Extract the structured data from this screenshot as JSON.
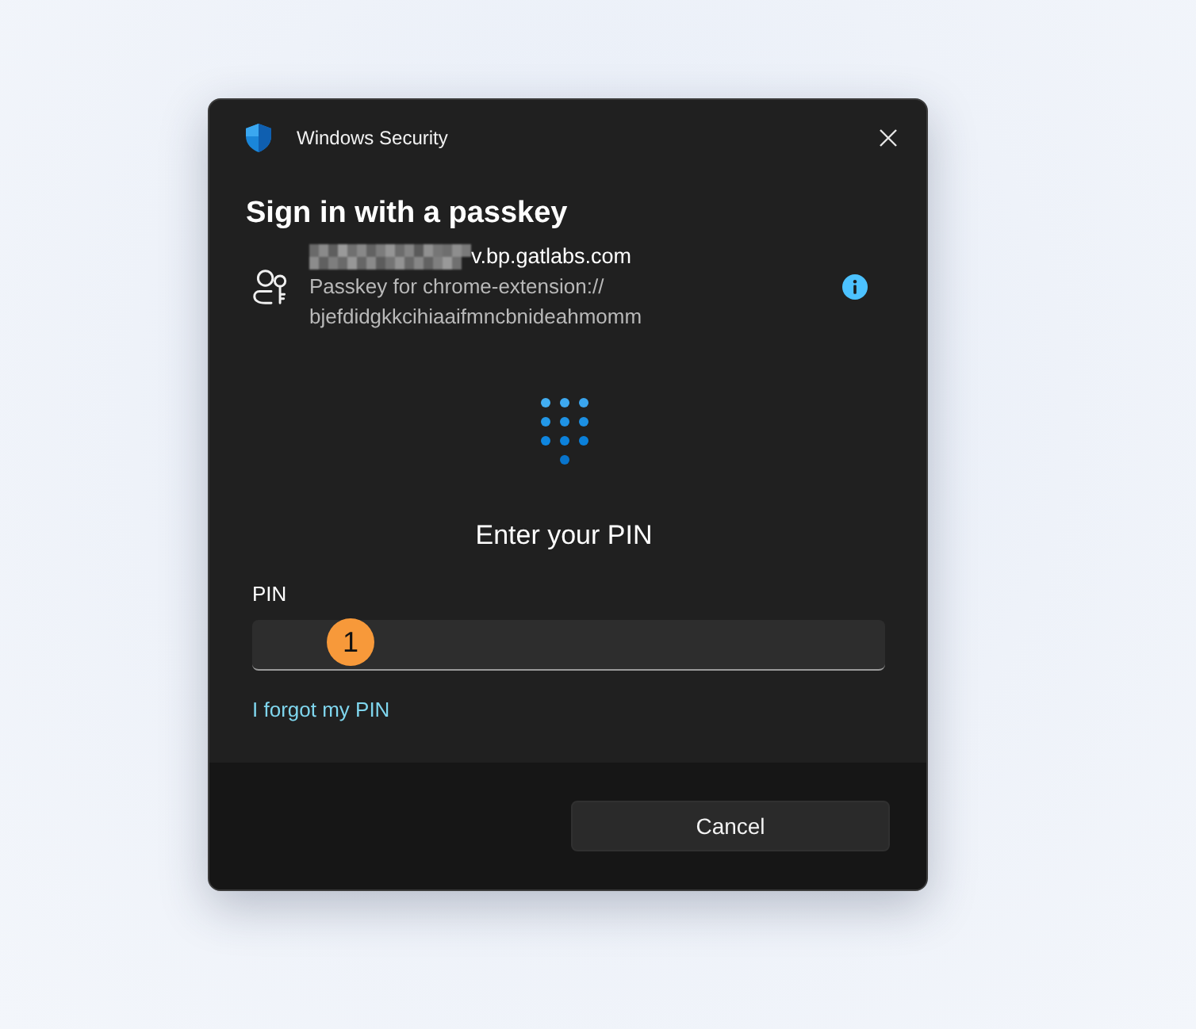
{
  "window": {
    "title": "Windows Security"
  },
  "dialog": {
    "heading": "Sign in with a passkey",
    "account": {
      "name_visible_part": "v.bp.gatlabs.com",
      "description": "Passkey for chrome-extension:// bjefdidgkkcihiaaifmncbnideahmomm"
    },
    "prompt": "Enter your PIN",
    "pin_field": {
      "label": "PIN"
    },
    "annotation": {
      "number": "1"
    },
    "link": "I forgot my PIN"
  },
  "buttons": [
    "Cancel"
  ]
}
